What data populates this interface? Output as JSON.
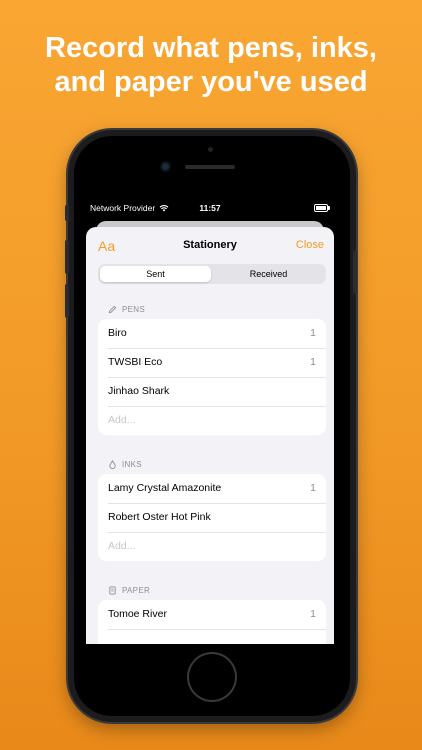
{
  "headline": {
    "line1": "Record what pens, inks,",
    "line2": "and paper you've used"
  },
  "status_bar": {
    "carrier": "Network Provider",
    "time": "11:57"
  },
  "nav": {
    "left": "Aa",
    "title": "Stationery",
    "right": "Close"
  },
  "segmented": {
    "sent": "Sent",
    "received": "Received"
  },
  "pens": {
    "header": "PENS",
    "items": [
      {
        "name": "Biro",
        "count": "1"
      },
      {
        "name": "TWSBI Eco",
        "count": "1"
      },
      {
        "name": "Jinhao Shark",
        "count": ""
      }
    ],
    "add_placeholder": "Add..."
  },
  "inks": {
    "header": "INKS",
    "items": [
      {
        "name": "Lamy Crystal Amazonite",
        "count": "1"
      },
      {
        "name": "Robert Oster Hot Pink",
        "count": ""
      }
    ],
    "add_placeholder": "Add..."
  },
  "paper": {
    "header": "PAPER",
    "items": [
      {
        "name": "Tomoe River",
        "count": "1"
      }
    ]
  },
  "colors": {
    "accent": "#f39c2a",
    "background": "#f5a331"
  }
}
